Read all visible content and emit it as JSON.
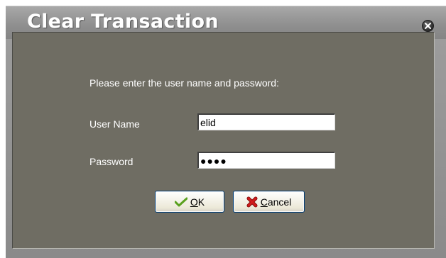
{
  "dialog": {
    "title": "Clear Transaction",
    "prompt": "Please enter the user name and password:",
    "username_label": "User Name",
    "username_value": "elid",
    "password_label": "Password",
    "password_value": "●●●●",
    "ok_accesskey": "O",
    "ok_rest": "K",
    "cancel_accesskey": "C",
    "cancel_rest": "ancel"
  },
  "icons": {
    "close": "close-icon",
    "ok": "checkmark-icon",
    "cancel": "red-x-icon"
  },
  "colors": {
    "panel_bg": "#6f6d63",
    "title_text": "#ffffff",
    "button_border": "#003c74",
    "check_green": "#5aa11e",
    "cancel_red": "#d21c1c"
  }
}
